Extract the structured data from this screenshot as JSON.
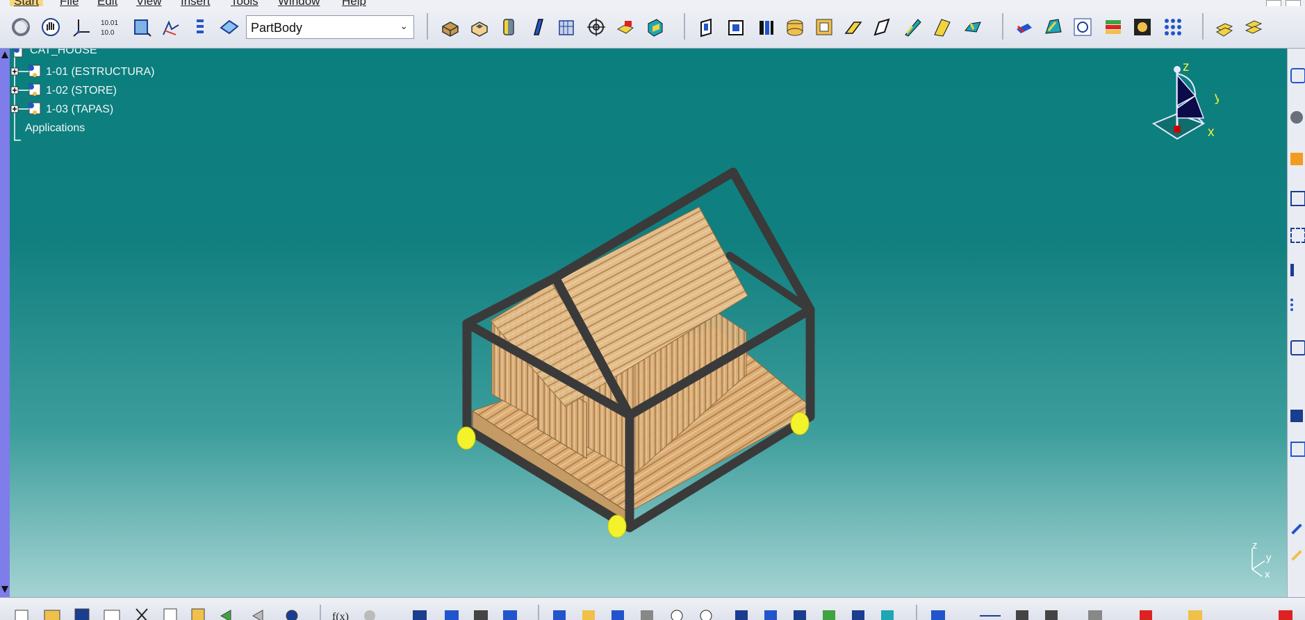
{
  "menu": {
    "items": [
      "Start",
      "File",
      "Edit",
      "View",
      "Insert",
      "Tools",
      "Window",
      "Help"
    ]
  },
  "toolbar": {
    "body_select_value": "PartBody",
    "icons": [
      "update-icon",
      "pan-hand-icon",
      "axis-system-icon",
      "points-grid-icon",
      "sketch-icon",
      "constraint-icon",
      "list-icon",
      "plane-icon",
      "pad-icon",
      "pocket-icon",
      "shaft-icon",
      "rib-icon",
      "multi-section-icon",
      "target-icon",
      "remove-icon",
      "solid-combine-icon",
      "hole-icon",
      "slot-icon",
      "stiffener-icon",
      "groove-icon",
      "thread-icon",
      "draft-icon",
      "shell-icon",
      "thickness-icon",
      "split-icon",
      "thick-surface-icon",
      "measure-icon",
      "map-icon",
      "analysis-icon",
      "layers-icon",
      "render-icon",
      "pattern-icon",
      "catalog-icon",
      "publish-icon"
    ]
  },
  "tree": {
    "root": "CAT_HOUSE",
    "items": [
      "1-01 (ESTRUCTURA)",
      "1-02 (STORE)",
      "1-03 (TAPAS)"
    ],
    "applications": "Applications"
  },
  "compass": {
    "z": "z",
    "y": "y",
    "x": "x"
  },
  "mini_axis": {
    "z": "z",
    "y": "y",
    "x": "x"
  },
  "colors": {
    "viewport_top": "#0a7f7e",
    "viewport_bottom": "#a5d3d3",
    "frame": "#3a3a3a",
    "wood": "#d4a774",
    "wheels": "#f3f32c",
    "compass_blue": "#0b0b4a"
  }
}
